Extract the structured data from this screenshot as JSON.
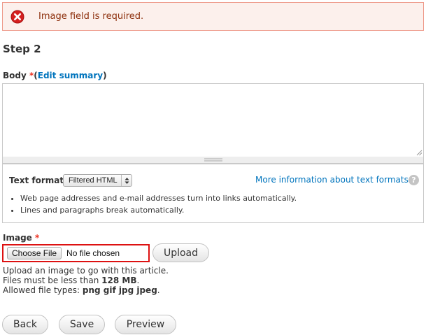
{
  "error": {
    "message": "Image field is required.",
    "icon": "error-x-icon",
    "color": "#d51f1f"
  },
  "form": {
    "step_title": "Step 2",
    "body": {
      "label": "Body",
      "required_mark": "*",
      "edit_summary_open": "(",
      "edit_summary_link": "Edit summary",
      "edit_summary_close": ")",
      "value": ""
    },
    "text_format": {
      "label": "Text format",
      "selected": "Filtered HTML",
      "more_info_link": "More information about text formats",
      "help_glyph": "?",
      "tips": [
        "Web page addresses and e-mail addresses turn into links automatically.",
        "Lines and paragraphs break automatically."
      ]
    },
    "image": {
      "label": "Image",
      "required_mark": "*",
      "choose_file_label": "Choose File",
      "no_file_text": "No file chosen",
      "upload_label": "Upload",
      "help_line1": "Upload an image to go with this article.",
      "help_line2_prefix": "Files must be less than",
      "help_line2_size": "128 MB",
      "help_line2_suffix": ".",
      "help_line3_prefix": "Allowed file types:",
      "help_line3_types": "png gif jpg jpeg",
      "help_line3_suffix": "."
    },
    "actions": {
      "back_label": "Back",
      "save_label": "Save",
      "preview_label": "Preview"
    }
  }
}
